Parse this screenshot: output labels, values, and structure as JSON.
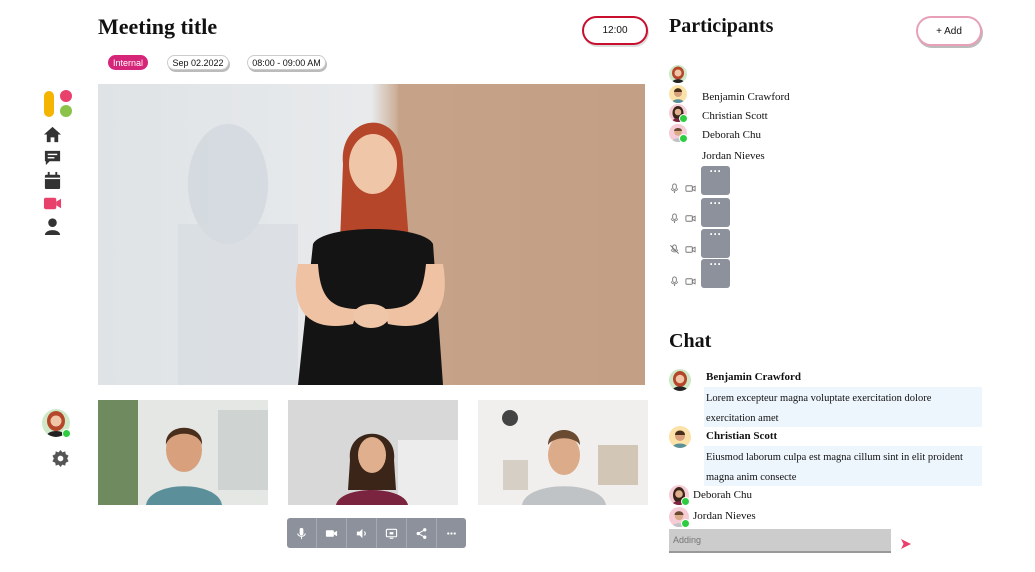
{
  "header": {
    "title": "Meeting title",
    "time": "12:00",
    "tags": {
      "internal": "Internal",
      "date": "Sep 02.2022",
      "time_range": "08:00 - 09:00 AM"
    }
  },
  "nav": {
    "items": [
      "home-icon",
      "chat-icon",
      "calendar-icon",
      "video-icon",
      "user-icon"
    ],
    "bottom": [
      "user-avatar",
      "settings-icon"
    ],
    "accent": "#e8416b"
  },
  "controls": [
    "mic-icon",
    "camera-icon",
    "speaker-icon",
    "screen-share-icon",
    "share-icon",
    "more-icon"
  ],
  "participants": {
    "title": "Participants",
    "add_label": "+ Add",
    "names": [
      "Benjamin Crawford",
      "Christian Scott",
      "Deborah Chu",
      "Jordan Nieves"
    ],
    "more_label": "···"
  },
  "chat": {
    "title": "Chat",
    "messages": [
      {
        "author": "Benjamin Crawford",
        "text": "Lorem excepteur magna voluptate exercitation dolore exercitation amet"
      },
      {
        "author": "Christian Scott",
        "text": "Eiusmod laborum culpa est magna cillum sint in elit proident magna anim consecte"
      },
      {
        "author": "Deborah Chu"
      },
      {
        "author": "Jordan Nieves"
      }
    ],
    "input_placeholder": "Adding",
    "send_color": "#e8416b"
  }
}
